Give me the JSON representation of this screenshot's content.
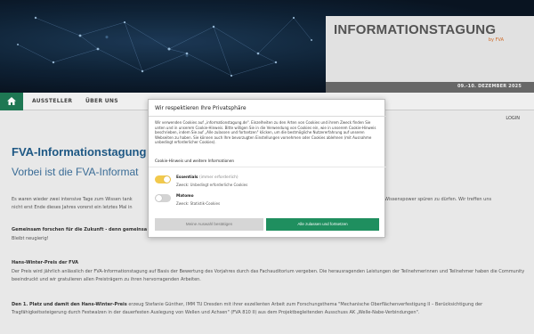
{
  "header": {
    "brand_title": "INFORMATIONSTAGUNG",
    "brand_sub": "by FVA",
    "date": "09.-10. DEZEMBER 2025"
  },
  "nav": {
    "items": [
      "AUSSTELLER",
      "ÜBER UNS"
    ],
    "login": "LOGIN"
  },
  "page": {
    "title": "FVA-Informationstagung -",
    "subtitle": "Vorbei ist die FVA-Informat",
    "intro_left": "Es waren wieder zwei intensive Tage zum Wissen tank",
    "intro_right": "Wissenspower spüren zu dürfen. Wir treffen uns",
    "intro_line2": "nicht erst Ende dieses Jahres vorerst ein letztes Mal in",
    "future_heading": "Gemeinsam forschen für die Zukunft - denn gemeinsa",
    "future_text": "Bleibt neugierig!",
    "prize_heading": "Hans-Winter-Preis der FVA",
    "prize_text": "Der Preis wird jährlich anlässlich der FVA-Informationstagung auf Basis der Bewertung des Vorjahres durch das Fachauditorium vergeben. Die herausragenden Leistungen der Teilnehmerinnen und Teilnehmer haben die Community beeindruckt und wir gratulieren allen Preisträgern zu ihren hervorragenden Arbeiten.",
    "winner_heading": "Den 1. Platz und damit den Hans-Winter-Preis",
    "winner_text": "erzeug Stefanie Günther, IMM TU Dresden mit ihrer exzellenten Arbeit zum Forschungsthema \"Mechanische Oberflächenverfestigung II – Berücksichtigung der Tragfähigkeitssteigerung durch Festwalzen in der dauerfesten Auslegung von Wellen und Achsen\" (FVA 810 II) aus dem Projektbegleitenden Ausschuss AK „Welle-Nabe-Verbindungen\"."
  },
  "cookie_dialog": {
    "title": "Wir respektieren Ihre Privatsphäre",
    "body": "Wir verwenden Cookies auf „informationstagung.de\". Einzelheiten zu den Arten von Cookies und ihrem Zweck finden Sie unten und in unserem Cookie-Hinweis. Bitte willigen Sie in die Verwendung von Cookies ein, wie in unserem Cookie-Hinweis beschrieben, indem Sie auf „Alle zulassen und fortsetzen\" klicken, um die bestmögliche Nutzererfahrung auf unseren Webseiten zu haben. Sie können auch Ihre bevorzugten Einstellungen vornehmen oder Cookies ablehnen (mit Ausnahme unbedingt erforderlicher Cookies).",
    "link": "Cookie-Hinweis und weitere Informationen",
    "options": [
      {
        "name": "Essentials",
        "note": "(immer erforderlich)",
        "desc": "Zweck: Unbedingt erforderliche Cookies",
        "enabled": true
      },
      {
        "name": "Matomo",
        "note": "",
        "desc": "Zweck: Statistik-Cookies",
        "enabled": false
      }
    ],
    "btn_confirm": "Meine Auswahl bestätigen",
    "btn_accept_all": "Alle zulassen und fortsetzen"
  },
  "colors": {
    "accent_green": "#1f8f5f",
    "title_blue": "#1f5a87",
    "toggle_on": "#f2c94c",
    "brand_orange": "#d36e2b"
  }
}
